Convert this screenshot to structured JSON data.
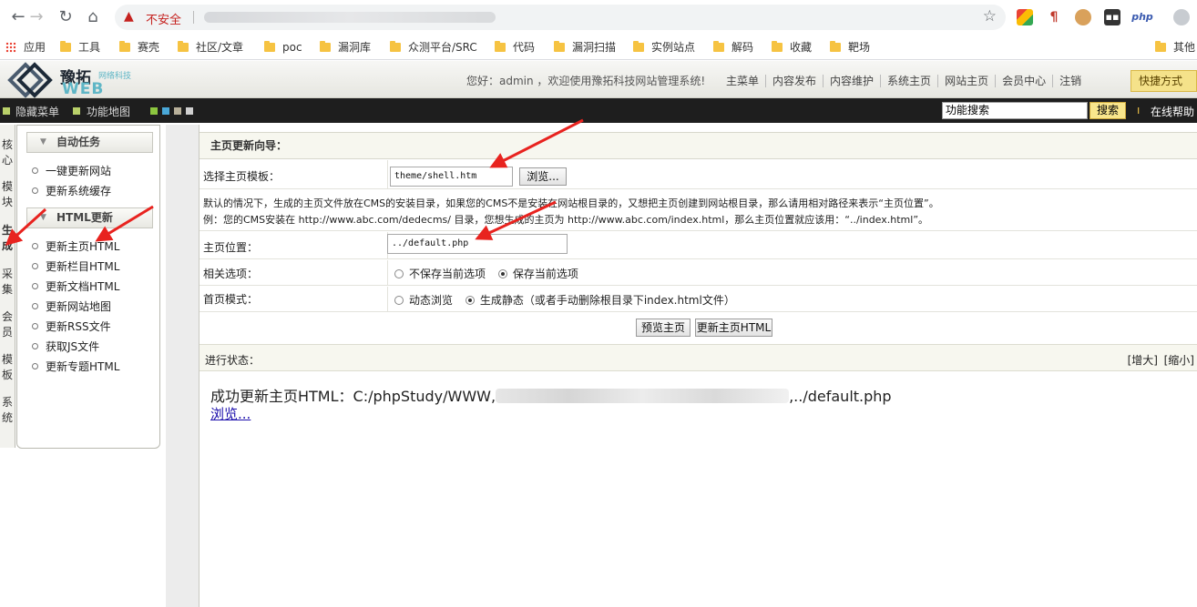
{
  "browser": {
    "security_label": "不安全",
    "bookmarks": [
      "应用",
      "工具",
      "赛壳",
      "社区/文章",
      "poc",
      "漏洞库",
      "众测平台/SRC",
      "代码",
      "漏洞扫描",
      "实例站点",
      "解码",
      "收藏",
      "靶场",
      "其他"
    ],
    "ext_php": "php"
  },
  "header": {
    "logo_cn": "豫拓",
    "logo_sub": "网络科技",
    "logo_web": "WEB",
    "welcome": "您好：admin ，欢迎使用豫拓科技网站管理系统!",
    "nav": [
      "主菜单",
      "内容发布",
      "内容维护",
      "系统主页",
      "网站主页",
      "会员中心",
      "注销"
    ],
    "quick_mode": "快捷方式"
  },
  "toolbar": {
    "hide_menu": "隐藏菜单",
    "site_map": "功能地图",
    "search_value": "功能搜索",
    "search_button": "搜索",
    "help": "在线帮助"
  },
  "vtabs": [
    "核心",
    "模块",
    "生成",
    "采集",
    "会员",
    "模板",
    "系统"
  ],
  "menu": {
    "group1_title": "自动任务",
    "group1_items": [
      "一键更新网站",
      "更新系统缓存"
    ],
    "group2_title": "HTML更新",
    "group2_items": [
      "更新主页HTML",
      "更新栏目HTML",
      "更新文档HTML",
      "更新网站地图",
      "更新RSS文件",
      "获取JS文件",
      "更新专题HTML"
    ]
  },
  "form": {
    "title": "主页更新向导：",
    "template_label": "选择主页模板：",
    "template_value": "theme/shell.htm",
    "browse_button": "浏览...",
    "note1": "默认的情况下，生成的主页文件放在CMS的安装目录，如果您的CMS不是安装在网站根目录的，又想把主页创建到网站根目录，那么请用相对路径来表示“主页位置”。",
    "note2": "例：您的CMS安装在 http://www.abc.com/dedecms/ 目录，您想生成的主页为 http://www.abc.com/index.html，那么主页位置就应该用：“../index.html”。",
    "location_label": "主页位置：",
    "location_value": "../default.php",
    "options_label": "相关选项：",
    "option_no_save": "不保存当前选项",
    "option_save": "保存当前选项",
    "mode_label": "首页模式：",
    "mode_dynamic": "动态浏览",
    "mode_static": "生成静态（或者手动删除根目录下index.html文件）",
    "preview_button": "预览主页",
    "update_button": "更新主页HTML",
    "status_label": "进行状态：",
    "enlarge": "[增大]",
    "shrink": "[缩小]",
    "result_prefix": "成功更新主页HTML：C:/phpStudy/WWW,",
    "result_mid": ",",
    "result_suffix": "../default.php",
    "result_link": "浏览..."
  }
}
